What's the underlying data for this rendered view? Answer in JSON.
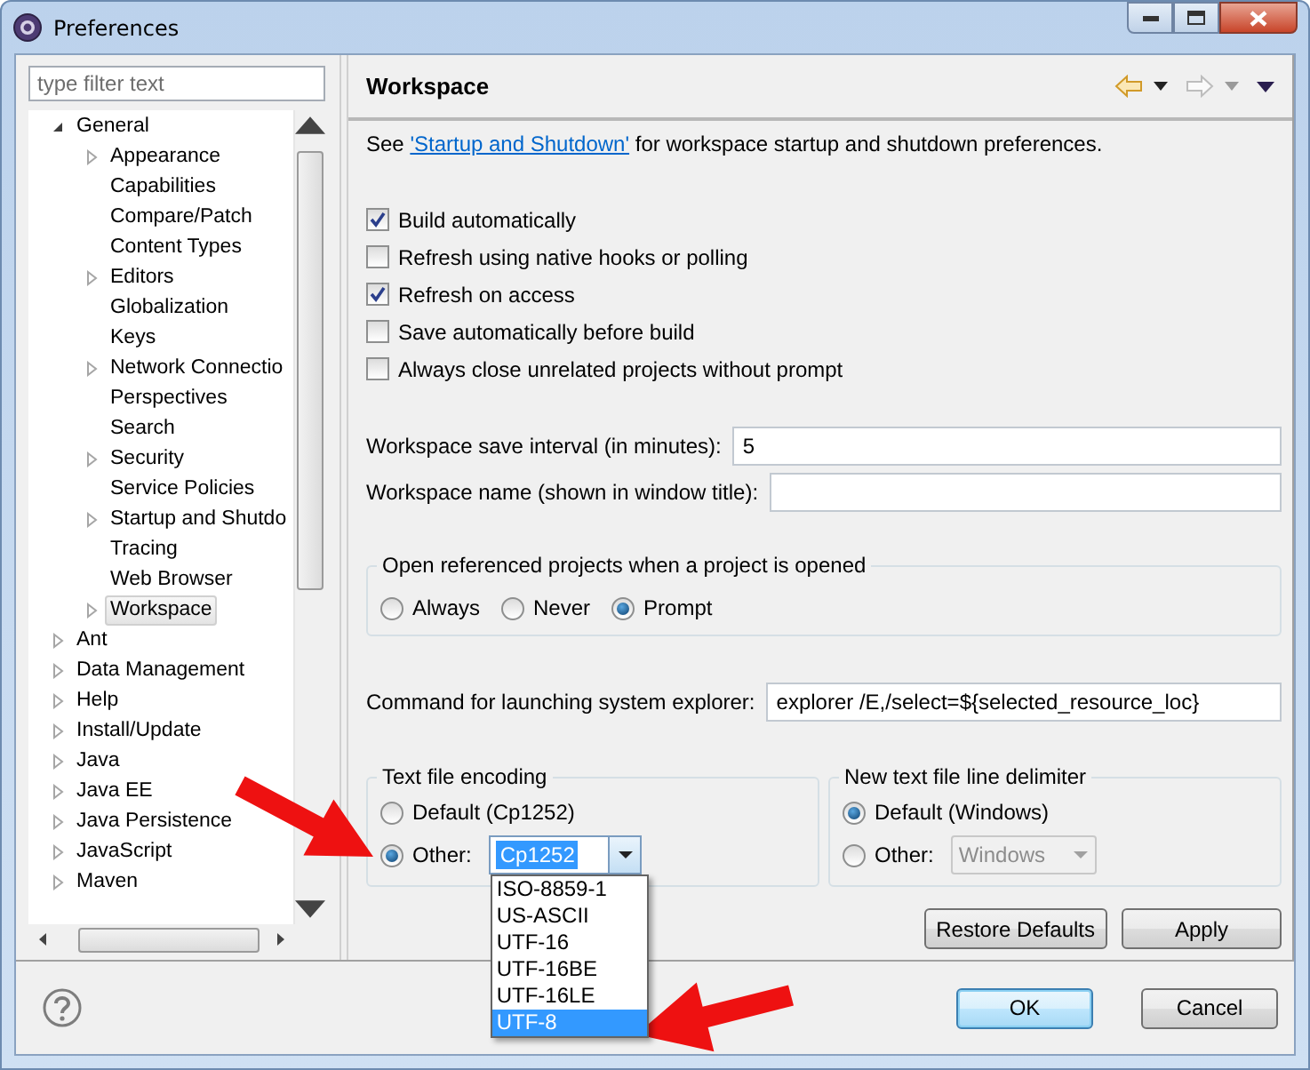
{
  "window": {
    "title": "Preferences"
  },
  "filter": {
    "placeholder": "type filter text"
  },
  "tree": [
    {
      "label": "General",
      "kind": "folder",
      "expanded": true,
      "selected": false,
      "children": [
        {
          "label": "Appearance",
          "kind": "folder",
          "expanded": false,
          "selected": false
        },
        {
          "label": "Capabilities",
          "kind": "page",
          "selected": false
        },
        {
          "label": "Compare/Patch",
          "kind": "page",
          "selected": false
        },
        {
          "label": "Content Types",
          "kind": "page",
          "selected": false
        },
        {
          "label": "Editors",
          "kind": "folder",
          "expanded": false,
          "selected": false
        },
        {
          "label": "Globalization",
          "kind": "page",
          "selected": false
        },
        {
          "label": "Keys",
          "kind": "page",
          "selected": false
        },
        {
          "label": "Network Connectio",
          "kind": "folder",
          "expanded": false,
          "selected": false
        },
        {
          "label": "Perspectives",
          "kind": "page",
          "selected": false
        },
        {
          "label": "Search",
          "kind": "page",
          "selected": false
        },
        {
          "label": "Security",
          "kind": "folder",
          "expanded": false,
          "selected": false
        },
        {
          "label": "Service Policies",
          "kind": "page",
          "selected": false
        },
        {
          "label": "Startup and Shutdo",
          "kind": "folder",
          "expanded": false,
          "selected": false
        },
        {
          "label": "Tracing",
          "kind": "page",
          "selected": false
        },
        {
          "label": "Web Browser",
          "kind": "page",
          "selected": false
        },
        {
          "label": "Workspace",
          "kind": "folder",
          "expanded": false,
          "selected": true
        }
      ]
    },
    {
      "label": "Ant",
      "kind": "folder",
      "expanded": false,
      "selected": false
    },
    {
      "label": "Data Management",
      "kind": "folder",
      "expanded": false,
      "selected": false
    },
    {
      "label": "Help",
      "kind": "folder",
      "expanded": false,
      "selected": false
    },
    {
      "label": "Install/Update",
      "kind": "folder",
      "expanded": false,
      "selected": false
    },
    {
      "label": "Java",
      "kind": "folder",
      "expanded": false,
      "selected": false
    },
    {
      "label": "Java EE",
      "kind": "folder",
      "expanded": false,
      "selected": false
    },
    {
      "label": "Java Persistence",
      "kind": "folder",
      "expanded": false,
      "selected": false
    },
    {
      "label": "JavaScript",
      "kind": "folder",
      "expanded": false,
      "selected": false
    },
    {
      "label": "Maven",
      "kind": "folder",
      "expanded": false,
      "selected": false
    }
  ],
  "page": {
    "title": "Workspace",
    "intro": {
      "prefix": "See",
      "link": "'Startup and Shutdown'",
      "suffix": "for workspace startup and shutdown preferences."
    }
  },
  "options": [
    {
      "label": "Build automatically",
      "checked": true
    },
    {
      "label": "Refresh using native hooks or polling",
      "checked": false
    },
    {
      "label": "Refresh on access",
      "checked": true
    },
    {
      "label": "Save automatically before build",
      "checked": false
    },
    {
      "label": "Always close unrelated projects without prompt",
      "checked": false
    }
  ],
  "fields": [
    {
      "label": "Workspace save interval (in minutes):",
      "value": "5"
    },
    {
      "label": "Workspace name (shown in window title):"
    }
  ],
  "open_projects": {
    "title": "Open referenced projects when a project is opened",
    "choices": [
      {
        "label": "Always",
        "selected": false
      },
      {
        "label": "Never",
        "selected": false
      },
      {
        "label": "Prompt",
        "selected": true
      }
    ]
  },
  "command": {
    "label": "Command for launching system explorer:",
    "value": "explorer /E,/select=${selected_resource_loc}"
  },
  "encoding": {
    "title": "Text file encoding",
    "choices": [
      {
        "label": "Default (Cp1252)",
        "selected": false
      },
      {
        "label": "Other:",
        "selected": true
      }
    ],
    "combo": {
      "value": "Cp1252",
      "disabled": false,
      "open": true,
      "options": [
        {
          "label": "ISO-8859-1",
          "selected": false
        },
        {
          "label": "US-ASCII",
          "selected": false
        },
        {
          "label": "UTF-16",
          "selected": false
        },
        {
          "label": "UTF-16BE",
          "selected": false
        },
        {
          "label": "UTF-16LE",
          "selected": false
        },
        {
          "label": "UTF-8",
          "selected": true
        }
      ]
    }
  },
  "delimiter": {
    "title": "New text file line delimiter",
    "choices": [
      {
        "label": "Default (Windows)",
        "selected": true
      },
      {
        "label": "Other:",
        "selected": false
      }
    ],
    "combo": {
      "value": "Windows",
      "disabled": true,
      "open": false
    }
  },
  "page_buttons": [
    {
      "label": "Restore Defaults"
    },
    {
      "label": "Apply"
    }
  ],
  "dialog_buttons": [
    {
      "label": "OK",
      "default": true
    },
    {
      "label": "Cancel",
      "default": false
    }
  ]
}
